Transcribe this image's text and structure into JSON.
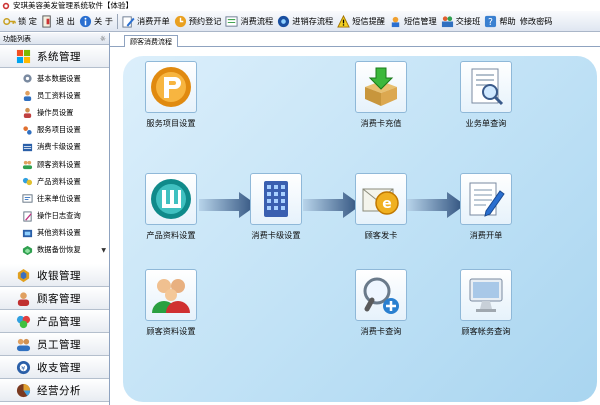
{
  "window": {
    "title": "安琪美容美发管理系统软件【体验】"
  },
  "toolbar": {
    "items": [
      {
        "label": "锁 定",
        "icon": "key-icon"
      },
      {
        "label": "退 出",
        "icon": "exit-icon"
      },
      {
        "label": "关 于",
        "icon": "info-icon"
      },
      {
        "label": "消费开单",
        "icon": "pen-icon"
      },
      {
        "label": "预约登记",
        "icon": "appointment-icon"
      },
      {
        "label": "消费流程",
        "icon": "flow-icon"
      },
      {
        "label": "进销存流程",
        "icon": "inventory-icon"
      },
      {
        "label": "短信提醒",
        "icon": "warning-icon"
      },
      {
        "label": "短信管理",
        "icon": "sms-icon"
      },
      {
        "label": "交接班",
        "icon": "shift-icon"
      },
      {
        "label": "帮助",
        "icon": "help-icon"
      },
      {
        "label": "修改密码",
        "icon": ""
      }
    ]
  },
  "sidebar": {
    "title": "功能列表",
    "pin": "☼",
    "active_group": {
      "label": "系统管理",
      "icon": "windows-logo-icon"
    },
    "sub_items": [
      {
        "label": "基本数据设置",
        "icon": "gear-icon"
      },
      {
        "label": "员工资料设置",
        "icon": "person-icon"
      },
      {
        "label": "操作员设置",
        "icon": "operator-icon"
      },
      {
        "label": "服务项目设置",
        "icon": "service-icon"
      },
      {
        "label": "消费卡级设置",
        "icon": "card-icon"
      },
      {
        "label": "顾客资料设置",
        "icon": "customer-icon"
      },
      {
        "label": "产品资料设置",
        "icon": "product-icon"
      },
      {
        "label": "往来单位设置",
        "icon": "partner-icon"
      },
      {
        "label": "操作日志查询",
        "icon": "log-icon"
      },
      {
        "label": "其他资料设置",
        "icon": "other-icon"
      },
      {
        "label": "数据备份恢复",
        "icon": "backup-icon"
      }
    ],
    "groups": [
      {
        "label": "收银管理",
        "icon": "cashier-icon"
      },
      {
        "label": "顾客管理",
        "icon": "customer-mgmt-icon"
      },
      {
        "label": "产品管理",
        "icon": "product-mgmt-icon"
      },
      {
        "label": "员工管理",
        "icon": "staff-mgmt-icon"
      },
      {
        "label": "收支管理",
        "icon": "finance-icon"
      },
      {
        "label": "经营分析",
        "icon": "analysis-icon"
      }
    ]
  },
  "main": {
    "tab": "顾客消费流程",
    "flow": {
      "service_setup": "服务项目设置",
      "card_recharge": "消费卡充值",
      "bill_query": "业务单查询",
      "product_setup": "产品资料设置",
      "card_level_setup": "消费卡级设置",
      "issue_card": "顾客发卡",
      "consume_bill": "消费开单",
      "customer_setup": "顾客资料设置",
      "card_query": "消费卡查询",
      "account_query": "顾客帐务查询"
    }
  }
}
